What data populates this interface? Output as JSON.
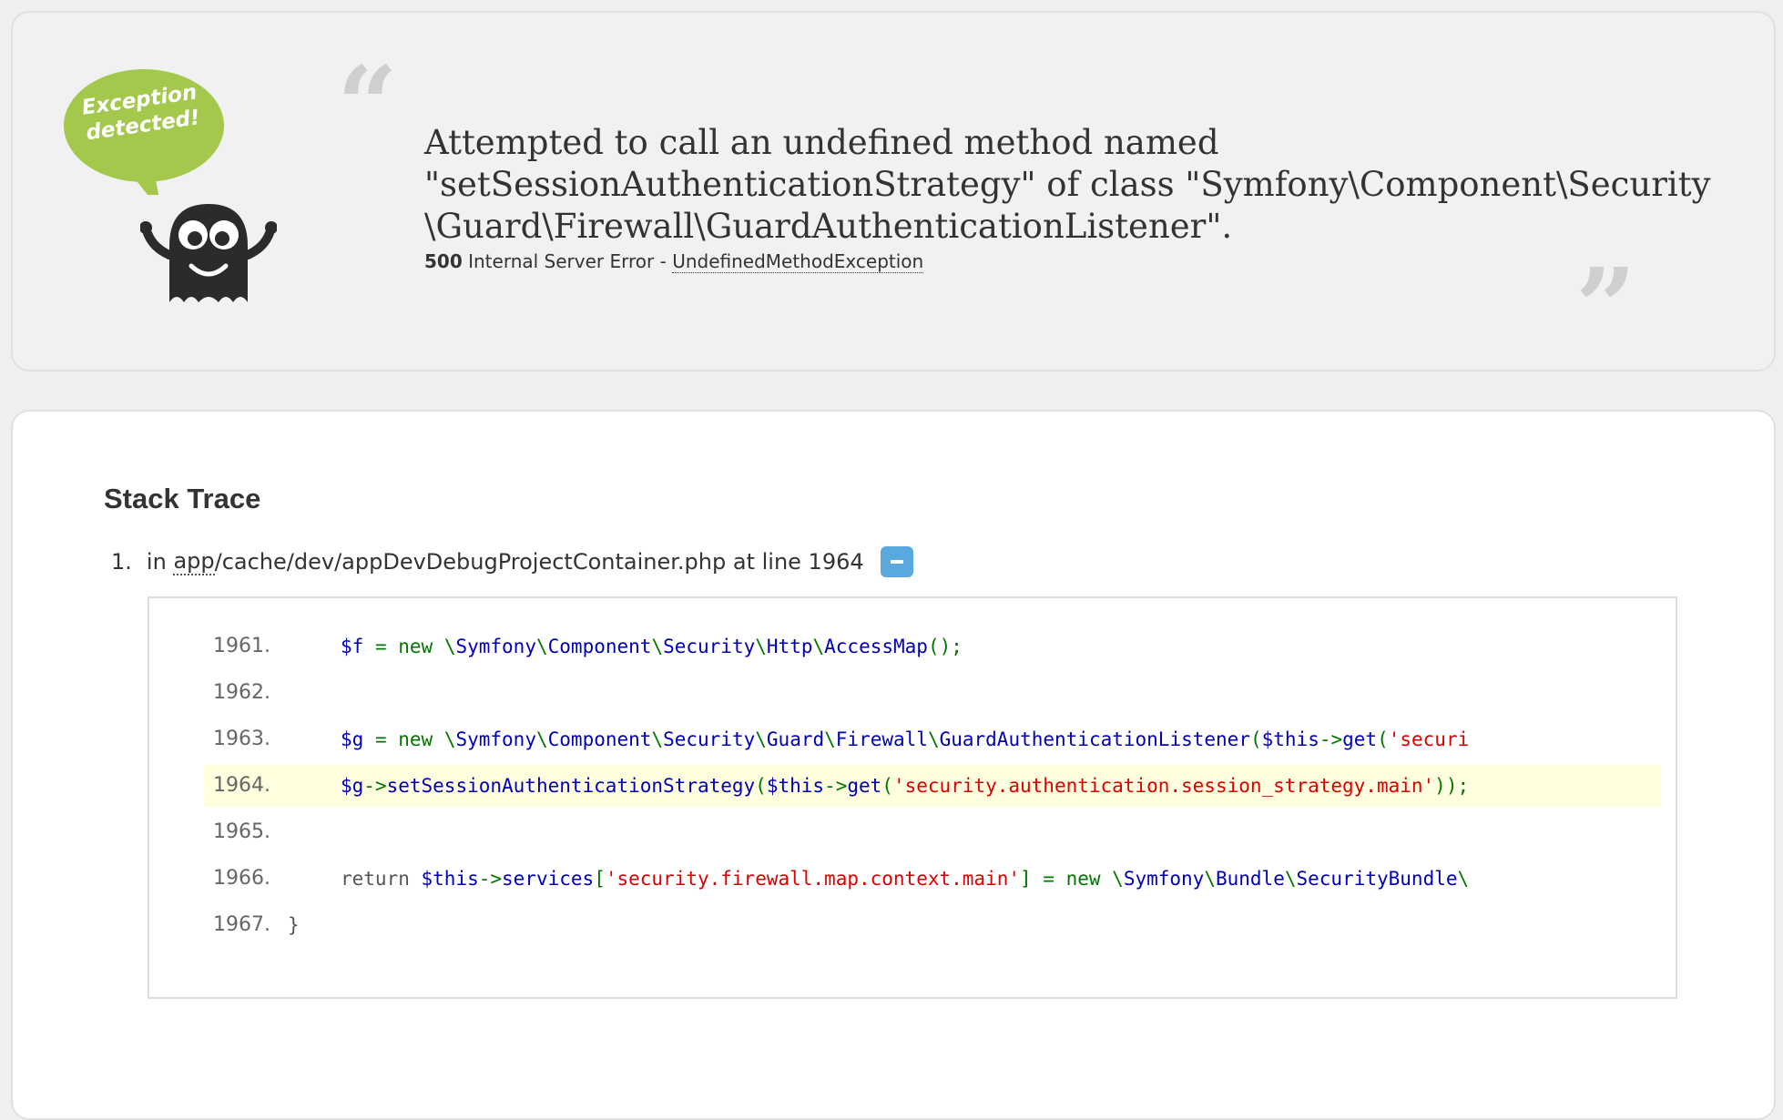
{
  "logo": {
    "bubble_line1": "Exception",
    "bubble_line2": "detected!",
    "bubble_color": "#a3c84c"
  },
  "header": {
    "message_line1": "Attempted to call an undefined method named",
    "message_line2": "\"setSessionAuthenticationStrategy\" of class \"Symfony\\Component\\Security",
    "message_line3": "\\Guard\\Firewall\\GuardAuthenticationListener\".",
    "status_code": "500",
    "status_text": "Internal Server Error",
    "separator": "-",
    "exception_class": "UndefinedMethodException"
  },
  "trace": {
    "title": "Stack Trace",
    "items": [
      {
        "number": "1.",
        "prefix": "in",
        "path_abbr": "app",
        "path_rest": "/cache/dev/appDevDebugProjectContainer.php",
        "at_line": "at line 1964"
      }
    ],
    "code_lines": [
      {
        "ln": "1961.",
        "t0": "$f",
        "t1": " = ",
        "t2": "new ",
        "t3": "\\",
        "t4": "Symfony",
        "t5": "\\",
        "t6": "Component",
        "t7": "\\",
        "t8": "Security",
        "t9": "\\",
        "t10": "Http",
        "t11": "\\",
        "t12": "AccessMap",
        "t13": "();"
      },
      {
        "ln": "1962."
      },
      {
        "ln": "1963.",
        "t0": "$g",
        "t1": " = ",
        "t2": "new ",
        "t3": "\\",
        "t4": "Symfony",
        "t5": "\\",
        "t6": "Component",
        "t7": "\\",
        "t8": "Security",
        "t9": "\\",
        "t10": "Guard",
        "t11": "\\",
        "t12": "Firewall",
        "t13": "\\",
        "t14": "GuardAuthenticationListener",
        "t15": "(",
        "t16": "$this",
        "t17": "->",
        "t18": "get",
        "t19": "(",
        "t20": "'securi"
      },
      {
        "ln": "1964.",
        "t0": "$g",
        "t1": "->",
        "t2": "setSessionAuthenticationStrategy",
        "t3": "(",
        "t4": "$this",
        "t5": "->",
        "t6": "get",
        "t7": "(",
        "t8": "'security.authentication.session_strategy.main'",
        "t9": "));"
      },
      {
        "ln": "1965."
      },
      {
        "ln": "1966.",
        "t0": "return ",
        "t1": "$this",
        "t2": "->",
        "t3": "services",
        "t4": "[",
        "t5": "'security.firewall.map.context.main'",
        "t6": "] = ",
        "t7": "new ",
        "t8": "\\",
        "t9": "Symfony",
        "t10": "\\",
        "t11": "Bundle",
        "t12": "\\",
        "t13": "SecurityBundle",
        "t14": "\\"
      },
      {
        "ln": "1967.",
        "t0": "}"
      }
    ],
    "toggle_color": "#5aa9de"
  }
}
